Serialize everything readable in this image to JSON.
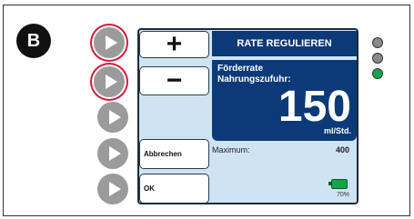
{
  "step_label": "B",
  "screen": {
    "title": "RATE REGULIEREN",
    "rate_label_line1": "Förderrate",
    "rate_label_line2": "Nahrungszufuhr:",
    "rate_value": "150",
    "rate_unit": "ml/Std.",
    "maximum_label": "Maximum:",
    "maximum_value": "400",
    "battery_percent": "70%"
  },
  "buttons": {
    "plus": "+",
    "minus": "−",
    "cancel": "Abbrechen",
    "ok": "OK"
  },
  "colors": {
    "header_blue": "#0c3a78",
    "screen_bg": "#cfe4f2",
    "highlight_ring": "#d01c3a",
    "led_off": "#8a8a8a",
    "led_on": "#16a34a"
  },
  "leds": [
    "gray",
    "gray",
    "green"
  ]
}
